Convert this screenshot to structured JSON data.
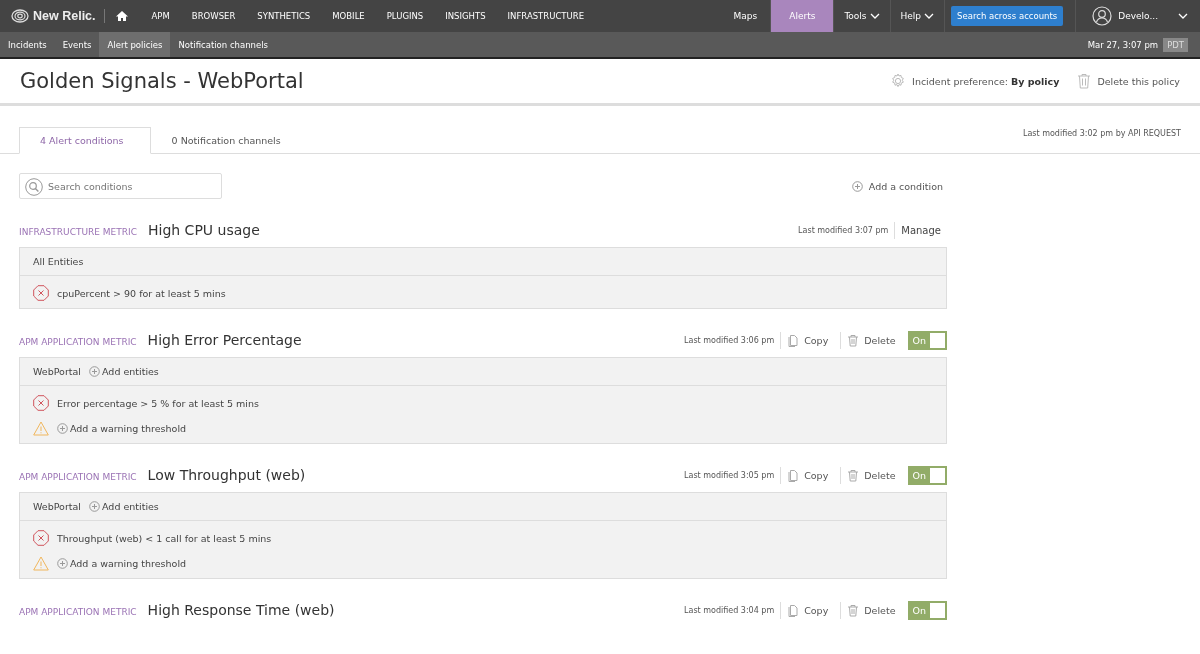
{
  "top_nav": {
    "logo": "New Relic.",
    "items": [
      {
        "label": "APM"
      },
      {
        "label": "BROWSER"
      },
      {
        "label": "SYNTHETICS"
      },
      {
        "label": "MOBILE"
      },
      {
        "label": "PLUGINS"
      },
      {
        "label": "INSIGHTS"
      },
      {
        "label": "INFRASTRUCTURE"
      }
    ],
    "right_items": [
      {
        "kind": "link",
        "label": "Maps",
        "selected": false
      },
      {
        "kind": "link",
        "label": "Alerts",
        "selected": true
      },
      {
        "kind": "menu",
        "label": "Tools"
      },
      {
        "kind": "menu",
        "label": "Help"
      },
      {
        "kind": "button",
        "label": "Search across accounts"
      },
      {
        "kind": "account",
        "label": "Develo..."
      }
    ]
  },
  "sub_nav": {
    "items": [
      {
        "label": "Incidents",
        "selected": false
      },
      {
        "label": "Events",
        "selected": false
      },
      {
        "label": "Alert policies",
        "selected": true
      },
      {
        "label": "Notification channels",
        "selected": false
      }
    ],
    "datetime": "Mar 27, 3:07 pm",
    "timezone": "PDT"
  },
  "policy": {
    "title": "Golden Signals - WebPortal",
    "incident_preference": "Incident preference: **By policy**",
    "delete": "Delete this policy"
  },
  "tabs": [
    {
      "label": "4 Alert conditions",
      "selected": true
    },
    {
      "label": "0 Notification channels",
      "selected": false
    }
  ],
  "last_modified": "Last modified 3:02 pm by API REQUEST",
  "search": {
    "placeholder": "Search conditions"
  },
  "add_condition": "Add a condition",
  "conditions": [
    {
      "type": "INFRASTRUCTURE METRIC",
      "name": "High CPU usage",
      "modified": "Last modified 3:07 pm",
      "actions": [
        {
          "kind": "manage",
          "label": "Manage"
        }
      ],
      "entity": "All Entities",
      "thresholds": [
        {
          "kind": "critical",
          "text": "cpuPercent > 90 for at least 5 mins"
        }
      ]
    },
    {
      "type": "APM APPLICATION METRIC",
      "name": "High Error Percentage",
      "modified": "Last modified 3:06 pm",
      "actions": [
        {
          "kind": "copy",
          "label": "Copy"
        },
        {
          "kind": "delete",
          "label": "Delete"
        },
        {
          "kind": "toggle",
          "label": "On",
          "on": true
        }
      ],
      "entity": "WebPortal",
      "add_entities": "Add entities",
      "thresholds": [
        {
          "kind": "critical",
          "text": "Error percentage > 5 % for at least 5 mins"
        },
        {
          "kind": "warning",
          "text": "Add a warning threshold"
        }
      ]
    },
    {
      "type": "APM APPLICATION METRIC",
      "name": "Low Throughput (web)",
      "modified": "Last modified 3:05 pm",
      "actions": [
        {
          "kind": "copy",
          "label": "Copy"
        },
        {
          "kind": "delete",
          "label": "Delete"
        },
        {
          "kind": "toggle",
          "label": "On",
          "on": true
        }
      ],
      "entity": "WebPortal",
      "add_entities": "Add entities",
      "thresholds": [
        {
          "kind": "critical",
          "text": "Throughput (web) < 1 call for at least 5 mins"
        },
        {
          "kind": "warning",
          "text": "Add a warning threshold"
        }
      ]
    },
    {
      "type": "APM APPLICATION METRIC",
      "name": "High Response Time (web)",
      "modified": "Last modified 3:04 pm",
      "actions": [
        {
          "kind": "copy",
          "label": "Copy"
        },
        {
          "kind": "delete",
          "label": "Delete"
        },
        {
          "kind": "toggle",
          "label": "On",
          "on": true
        }
      ]
    }
  ]
}
